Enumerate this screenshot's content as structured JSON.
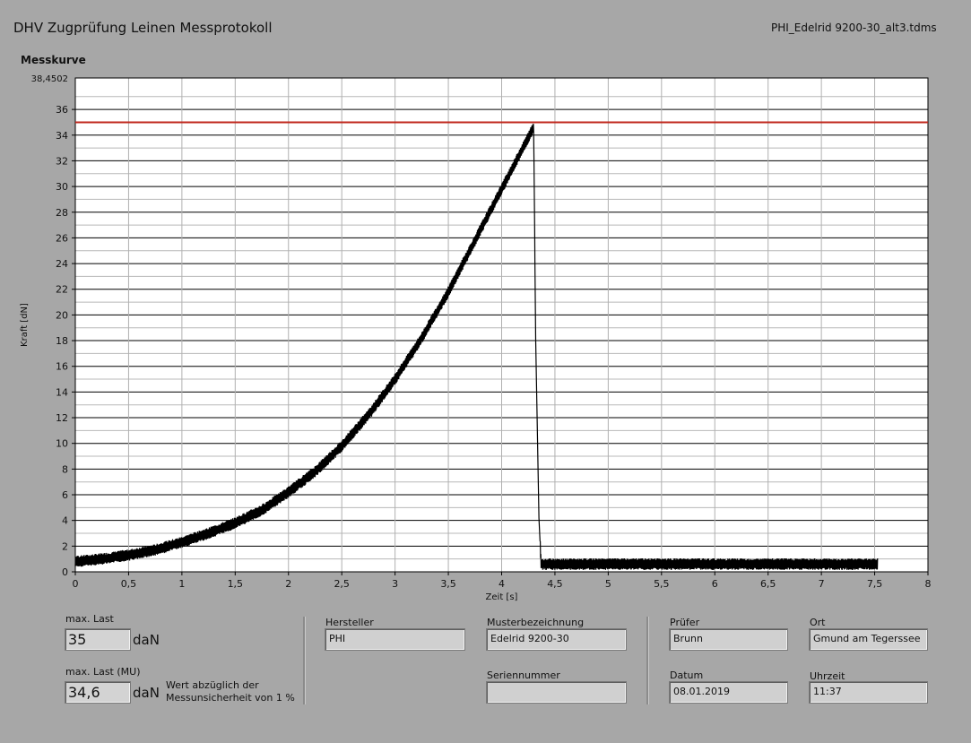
{
  "header": {
    "title": "DHV Zugprüfung Leinen Messprotokoll",
    "filename": "PHI_Edelrid 9200-30_alt3.tdms",
    "plot_caption": "Messkurve"
  },
  "chart_data": {
    "type": "line",
    "xlabel": "Zeit [s]",
    "ylabel": "Kraft [dN]",
    "xlim": [
      0,
      8
    ],
    "ylim": [
      0,
      38.4502
    ],
    "y_top_label": "38,4502",
    "x_ticks": [
      "0",
      "0,5",
      "1",
      "1,5",
      "2",
      "2,5",
      "3",
      "3,5",
      "4",
      "4,5",
      "5",
      "5,5",
      "6",
      "6,5",
      "7",
      "7,5",
      "8"
    ],
    "y_ticks": [
      "0",
      "2",
      "4",
      "6",
      "8",
      "10",
      "12",
      "14",
      "16",
      "18",
      "20",
      "22",
      "24",
      "26",
      "28",
      "30",
      "32",
      "34",
      "36"
    ],
    "grid": true,
    "series": [
      {
        "color": "#000000",
        "x": [
          0,
          0.25,
          0.5,
          0.75,
          1.0,
          1.25,
          1.5,
          1.75,
          2.0,
          2.25,
          2.5,
          2.75,
          3.0,
          3.25,
          3.5,
          3.75,
          4.0,
          4.2,
          4.3,
          4.32,
          4.35,
          4.37,
          4.5,
          5.0,
          6.0,
          7.0,
          7.53
        ],
        "y": [
          0.8,
          1.0,
          1.3,
          1.7,
          2.3,
          3.0,
          3.8,
          4.8,
          6.2,
          7.8,
          9.8,
          12.2,
          15.0,
          18.2,
          21.8,
          25.8,
          29.8,
          33.0,
          34.6,
          18.0,
          4.2,
          0.6,
          0.6,
          0.6,
          0.6,
          0.6,
          0.6
        ],
        "noise_band": 0.9
      },
      {
        "color": "#c0281e",
        "x": [
          0,
          8
        ],
        "y": [
          35,
          35
        ]
      }
    ]
  },
  "results": {
    "max_last_label": "max. Last",
    "max_last_value": "35",
    "max_last_unit": "daN",
    "max_last_mu_label": "max. Last (MU)",
    "max_last_mu_value": "34,6",
    "max_last_mu_unit": "daN",
    "note_line1": "Wert abzüglich der",
    "note_line2": "Messunsicherheit von 1 %"
  },
  "info": {
    "hersteller_label": "Hersteller",
    "hersteller_value": "PHI",
    "muster_label": "Musterbezeichnung",
    "muster_value": "Edelrid 9200-30",
    "serien_label": "Seriennummer",
    "serien_value": "",
    "pruefer_label": "Prüfer",
    "pruefer_value": "Brunn",
    "ort_label": "Ort",
    "ort_value": "Gmund am Tegerssee",
    "datum_label": "Datum",
    "datum_value": "08.01.2019",
    "uhrzeit_label": "Uhrzeit",
    "uhrzeit_value": "11:37"
  }
}
